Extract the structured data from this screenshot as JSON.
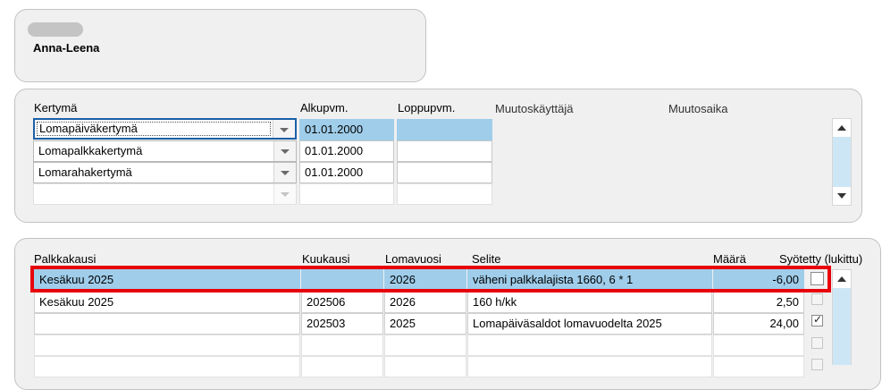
{
  "header": {
    "name": "Anna-Leena"
  },
  "accrual": {
    "columns": {
      "type": "Kertymä",
      "start": "Alkupvm.",
      "end": "Loppupvm.",
      "changed_by": "Muutoskäyttäjä",
      "changed_at": "Muutosaika"
    },
    "rows": [
      {
        "type": "Lomapäiväkertymä",
        "start": "01.01.2000",
        "end": ""
      },
      {
        "type": "Lomapalkkakertymä",
        "start": "01.01.2000",
        "end": ""
      },
      {
        "type": "Lomarahakertymä",
        "start": "01.01.2000",
        "end": ""
      },
      {
        "type": "",
        "start": "",
        "end": ""
      }
    ]
  },
  "entries": {
    "columns": {
      "period": "Palkkakausi",
      "month": "Kuukausi",
      "holiday_year": "Lomavuosi",
      "description": "Selite",
      "amount": "Määrä",
      "entered": "Syötetty (lukittu)"
    },
    "rows": [
      {
        "period": "Kesäkuu 2025",
        "month": "",
        "holiday_year": "2026",
        "description": "väheni palkkalajista 1660, 6 * 1",
        "amount": "-6,00",
        "entered": false
      },
      {
        "period": "Kesäkuu 2025",
        "month": "202506",
        "holiday_year": "2026",
        "description": "160 h/kk",
        "amount": "2,50",
        "entered": false
      },
      {
        "period": "",
        "month": "202503",
        "holiday_year": "2025",
        "description": "Lomapäiväsaldot lomavuodelta 2025",
        "amount": "24,00",
        "entered": true
      },
      {
        "period": "",
        "month": "",
        "holiday_year": "",
        "description": "",
        "amount": "",
        "entered": false
      },
      {
        "period": "",
        "month": "",
        "holiday_year": "",
        "description": "",
        "amount": "",
        "entered": false
      }
    ]
  },
  "colors": {
    "selection": "#9fcdea",
    "highlight_border": "#e8000b",
    "focus_border": "#1b5fa8"
  }
}
